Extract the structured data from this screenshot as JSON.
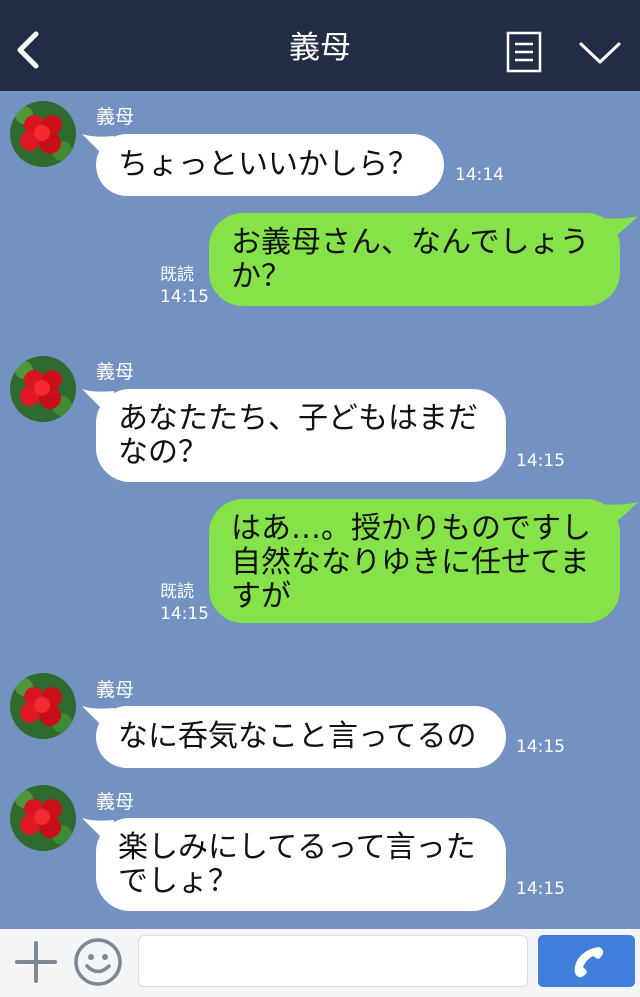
{
  "header": {
    "title": "義母",
    "back_icon": "chevron-left-icon",
    "menu_icon": "menu-icon",
    "collapse_icon": "chevron-down-icon",
    "background": "#232c45"
  },
  "chat": {
    "background": "#7392c2",
    "incoming_color": "#ffffff",
    "outgoing_color": "#85e249",
    "messages": [
      {
        "direction": "in",
        "sender": "義母",
        "text": "ちょっといいかしら？",
        "time": "14:14"
      },
      {
        "direction": "out",
        "text": "お義母さん、なんでしょう\nか？",
        "read": "既読",
        "time": "14:15"
      },
      {
        "direction": "in",
        "sender": "義母",
        "text": "あなたたち、子どもはまだ\nなの？",
        "time": "14:15"
      },
      {
        "direction": "out",
        "text": "はあ…。授かりものですし\n自然ななりゆきに任せてま\nすが",
        "read": "既読",
        "time": "14:15"
      },
      {
        "direction": "in",
        "sender": "義母",
        "text": "なに呑気なこと言ってるの",
        "time": "14:15"
      },
      {
        "direction": "in",
        "sender": "義母",
        "text": "楽しみにしてるって言った\nでしょ？",
        "time": "14:15"
      }
    ]
  },
  "bottom_bar": {
    "plus_icon": "plus-icon",
    "emoji_icon": "smiley-icon",
    "input_value": "",
    "input_placeholder": "",
    "call_icon": "phone-icon",
    "call_color": "#3f7fdb"
  }
}
